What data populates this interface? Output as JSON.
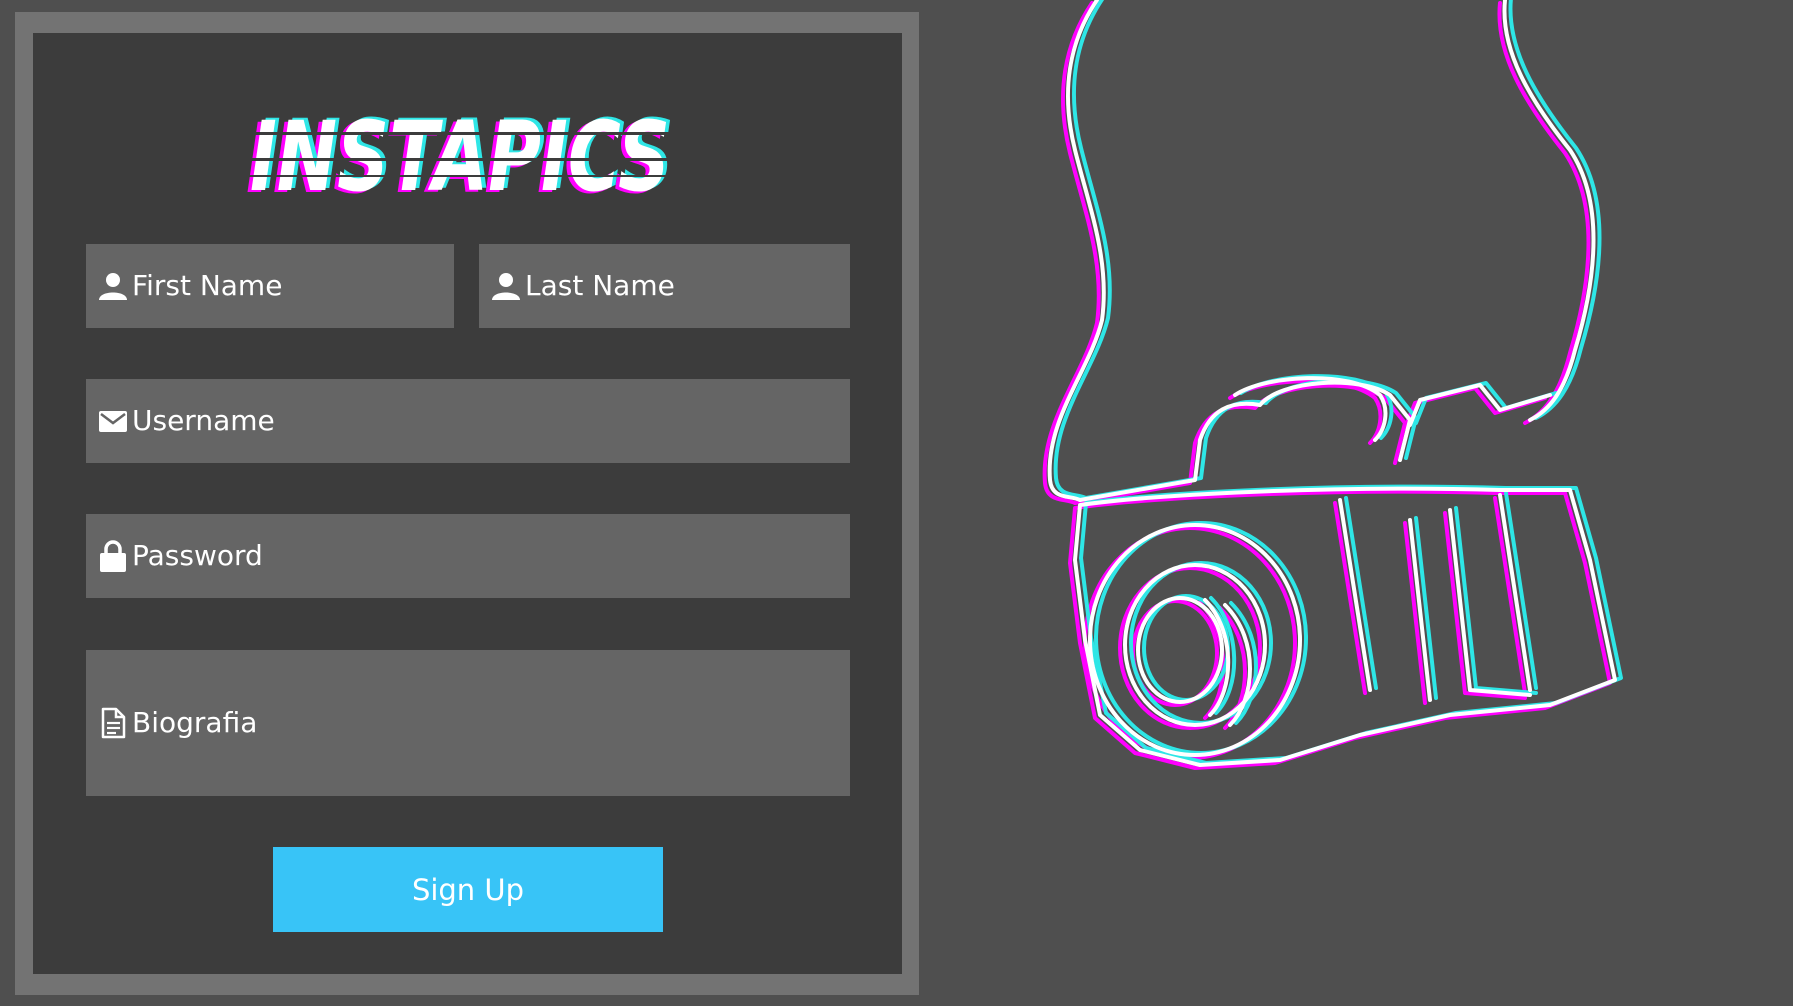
{
  "brand": {
    "title": "INSTAPICS"
  },
  "form": {
    "first_name": {
      "label": "First Name",
      "icon": "user-icon"
    },
    "last_name": {
      "label": "Last Name",
      "icon": "user-icon"
    },
    "username": {
      "label": "Username",
      "icon": "envelope-icon"
    },
    "password": {
      "label": "Password",
      "icon": "lock-icon"
    },
    "bio": {
      "label": "Biografia",
      "icon": "document-icon"
    },
    "submit_label": "Sign Up"
  },
  "illustration": {
    "icon": "camera-illustration"
  },
  "colors": {
    "page_bg": "#4f4f4f",
    "frame": "#737373",
    "panel": "#3c3c3c",
    "field": "#656565",
    "button": "#38c4f7",
    "glitch_cyan": "#2ee6e6",
    "glitch_magenta": "#ff00ff"
  }
}
